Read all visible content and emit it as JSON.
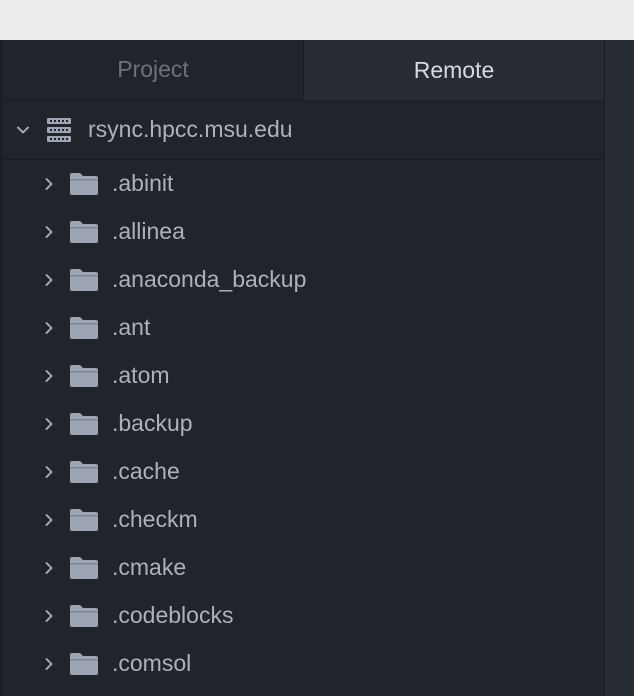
{
  "tabs": [
    {
      "label": "Project",
      "active": false
    },
    {
      "label": "Remote",
      "active": true
    }
  ],
  "root": {
    "label": "rsync.hpcc.msu.edu",
    "icon": "server-icon",
    "expanded": true
  },
  "folders": [
    {
      "label": ".abinit"
    },
    {
      "label": ".allinea"
    },
    {
      "label": ".anaconda_backup"
    },
    {
      "label": ".ant"
    },
    {
      "label": ".atom"
    },
    {
      "label": ".backup"
    },
    {
      "label": ".cache"
    },
    {
      "label": ".checkm"
    },
    {
      "label": ".cmake"
    },
    {
      "label": ".codeblocks"
    },
    {
      "label": ".comsol"
    }
  ],
  "colors": {
    "panel_bg": "#21252b",
    "active_tab_bg": "#282c34",
    "text": "#abb2bf",
    "icon": "#9da5b4"
  }
}
